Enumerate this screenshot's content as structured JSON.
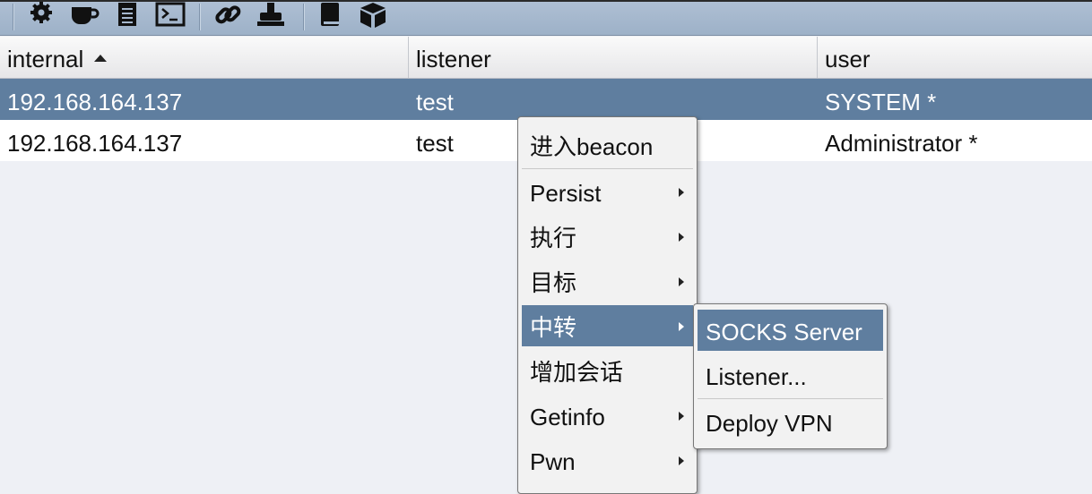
{
  "toolbar": {
    "icons": [
      "gear-icon",
      "coffee-cup-icon",
      "document-icon",
      "terminal-icon",
      "link-icon",
      "stamp-icon",
      "book-icon",
      "package-icon"
    ]
  },
  "table": {
    "columns": [
      {
        "label": "internal",
        "sorted": "ascending"
      },
      {
        "label": "listener"
      },
      {
        "label": "user"
      }
    ],
    "rows": [
      {
        "internal": "192.168.164.137",
        "listener": "test",
        "user": "SYSTEM *",
        "selected": true
      },
      {
        "internal": "192.168.164.137",
        "listener": "test",
        "user": "Administrator *",
        "selected": false
      }
    ]
  },
  "context_menu": {
    "items": [
      {
        "label": "进入beacon",
        "submenu": false
      },
      {
        "label": "Persist",
        "submenu": true
      },
      {
        "label": "执行",
        "submenu": true
      },
      {
        "label": "目标",
        "submenu": true
      },
      {
        "label": "中转",
        "submenu": true,
        "highlighted": true
      },
      {
        "label": "增加会话",
        "submenu": false
      },
      {
        "label": "Getinfo",
        "submenu": true
      },
      {
        "label": "Pwn",
        "submenu": true
      }
    ]
  },
  "submenu": {
    "items": [
      {
        "label": "SOCKS Server",
        "highlighted": true
      },
      {
        "label": "Listener..."
      },
      {
        "label": "Deploy VPN"
      }
    ]
  },
  "colors": {
    "selection": "#5f7e9f",
    "toolbar": "#a6b8ce",
    "background": "#eef0f5"
  }
}
